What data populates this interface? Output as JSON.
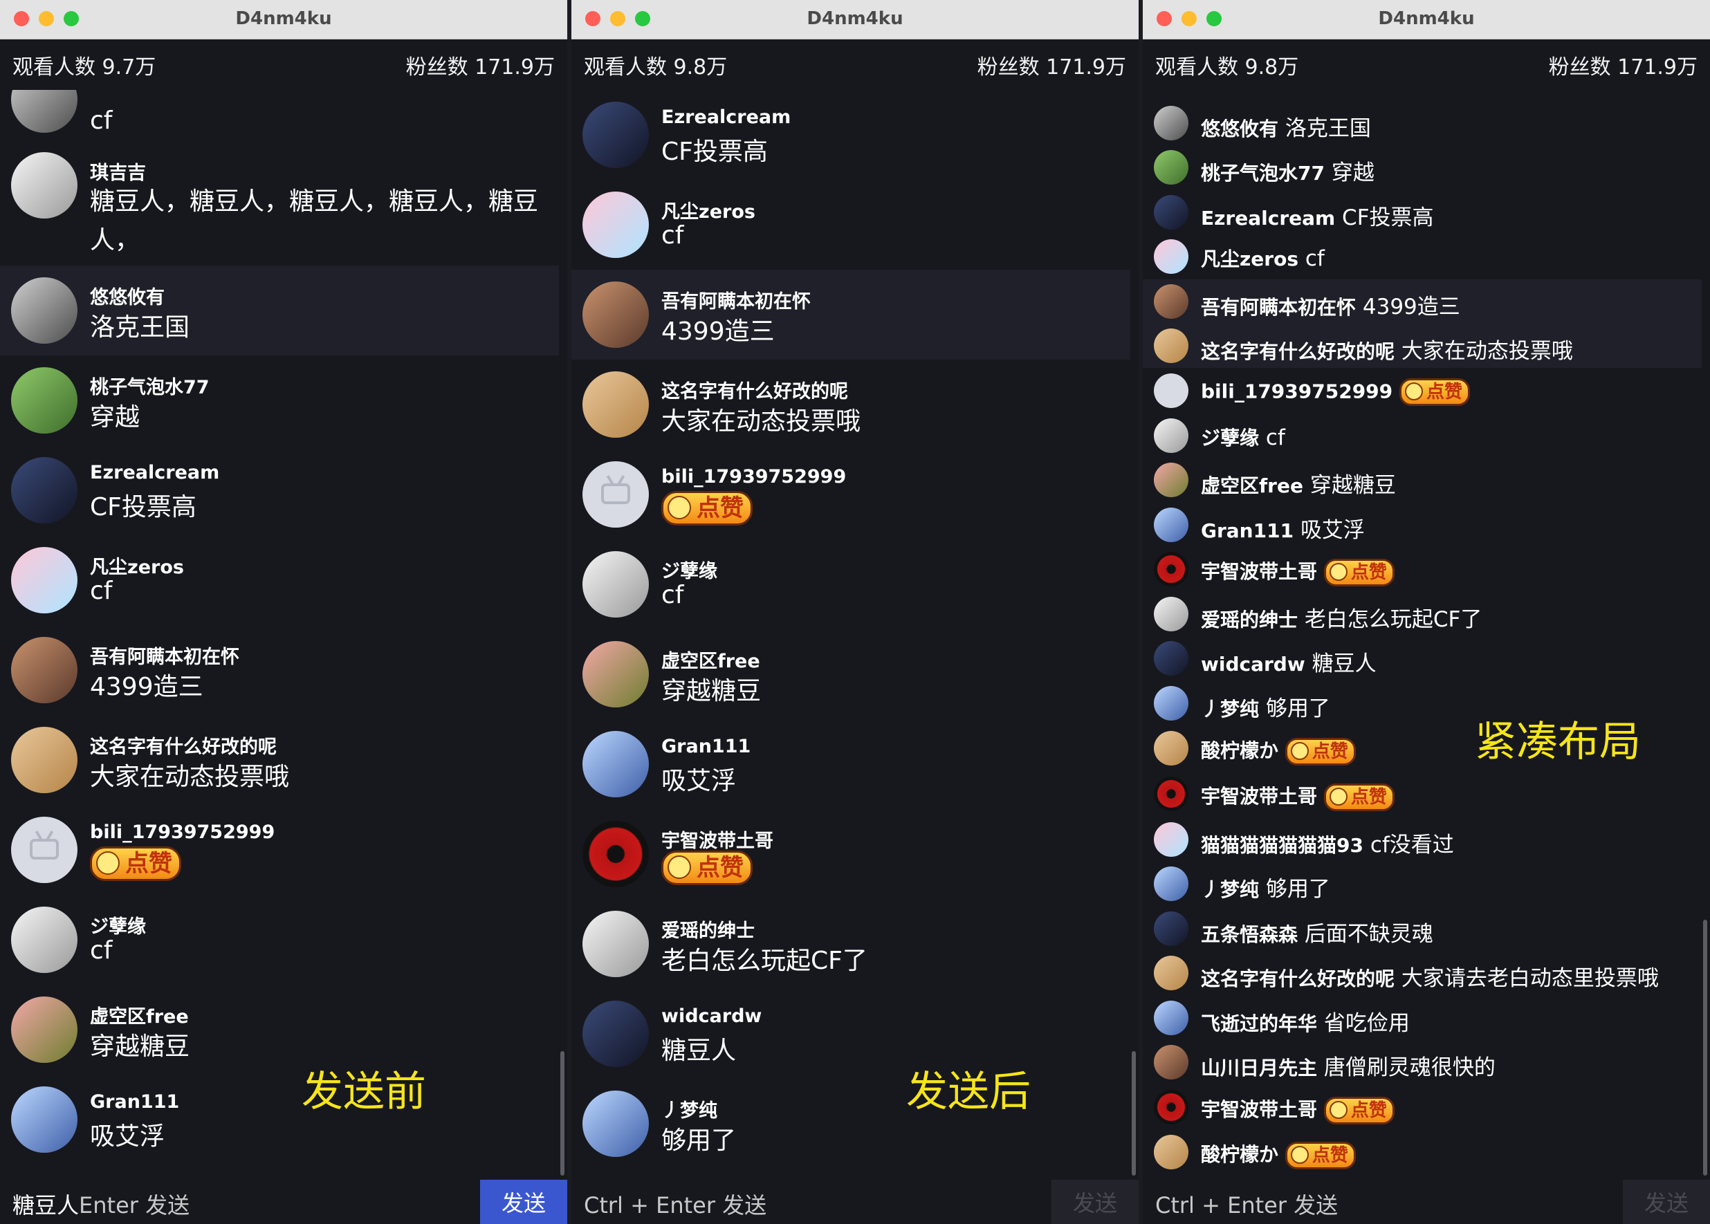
{
  "window_title": "D4nm4ku",
  "colors": {
    "send_active": "#3a57d0",
    "caption": "#f6e51a",
    "background": "#17181e"
  },
  "windows": [
    {
      "viewers": "观看人数 9.7万",
      "fans": "粉丝数 171.9万",
      "caption": "发送前",
      "items": [
        {
          "user": "",
          "text": "cf"
        },
        {
          "user": "琪吉吉",
          "text": "糖豆人，糖豆人，糖豆人，糖豆人，糖豆人，"
        },
        {
          "user": "悠悠攸有",
          "text": "洛克王国"
        },
        {
          "user": "桃子气泡水77",
          "text": "穿越"
        },
        {
          "user": "Ezrealcream",
          "text": "CF投票高"
        },
        {
          "user": "凡尘zeros",
          "text": "cf"
        },
        {
          "user": "吾有阿瞒本初在怀",
          "text": "4399造三"
        },
        {
          "user": "这名字有什么好改的呢",
          "text": "大家在动态投票哦"
        },
        {
          "user": "bili_17939752999",
          "text": "点赞"
        },
        {
          "user": "ジ孽缘",
          "text": "cf"
        },
        {
          "user": "虚空区free",
          "text": "穿越糖豆"
        },
        {
          "user": "Gran111",
          "text": "吸艾浮"
        }
      ],
      "input_value": "糖豆人",
      "input_placeholder": "Enter 发送",
      "send_label": "发送"
    },
    {
      "viewers": "观看人数 9.8万",
      "fans": "粉丝数 171.9万",
      "caption": "发送后",
      "items": [
        {
          "user": "Ezrealcream",
          "text": "CF投票高"
        },
        {
          "user": "凡尘zeros",
          "text": "cf"
        },
        {
          "user": "吾有阿瞒本初在怀",
          "text": "4399造三"
        },
        {
          "user": "这名字有什么好改的呢",
          "text": "大家在动态投票哦"
        },
        {
          "user": "bili_17939752999",
          "text": "点赞"
        },
        {
          "user": "ジ孽缘",
          "text": "cf"
        },
        {
          "user": "虚空区free",
          "text": "穿越糖豆"
        },
        {
          "user": "Gran111",
          "text": "吸艾浮"
        },
        {
          "user": "宇智波带土哥",
          "text": "点赞"
        },
        {
          "user": "爱瑶的绅士",
          "text": "老白怎么玩起CF了"
        },
        {
          "user": "widcardw",
          "text": "糖豆人"
        },
        {
          "user": "丿梦纯",
          "text": "够用了"
        }
      ],
      "input_placeholder": "Ctrl + Enter 发送",
      "send_label": "发送"
    },
    {
      "viewers": "观看人数 9.8万",
      "fans": "粉丝数 171.9万",
      "caption": "紧凑布局",
      "items": [
        {
          "user": "悠悠攸有",
          "text": "洛克王国"
        },
        {
          "user": "桃子气泡水77",
          "text": "穿越"
        },
        {
          "user": "Ezrealcream",
          "text": "CF投票高"
        },
        {
          "user": "凡尘zeros",
          "text": "cf"
        },
        {
          "user": "吾有阿瞒本初在怀",
          "text": "4399造三"
        },
        {
          "user": "这名字有什么好改的呢",
          "text": "大家在动态投票哦"
        },
        {
          "user": "bili_17939752999",
          "text": "点赞"
        },
        {
          "user": "ジ孽缘",
          "text": "cf"
        },
        {
          "user": "虚空区free",
          "text": "穿越糖豆"
        },
        {
          "user": "Gran111",
          "text": "吸艾浮"
        },
        {
          "user": "宇智波带土哥",
          "text": "点赞"
        },
        {
          "user": "爱瑶的绅士",
          "text": "老白怎么玩起CF了"
        },
        {
          "user": "widcardw",
          "text": "糖豆人"
        },
        {
          "user": "丿梦纯",
          "text": "够用了"
        },
        {
          "user": "酸柠檬か",
          "text": "点赞"
        },
        {
          "user": "宇智波带土哥",
          "text": "点赞"
        },
        {
          "user": "猫猫猫猫猫猫猫93",
          "text": "cf没看过"
        },
        {
          "user": "丿梦纯",
          "text": "够用了"
        },
        {
          "user": "五条悟森森",
          "text": "后面不缺灵魂"
        },
        {
          "user": "这名字有什么好改的呢",
          "text": "大家请去老白动态里投票哦"
        },
        {
          "user": "飞逝过的年华",
          "text": "省吃俭用"
        },
        {
          "user": "山川日月先主",
          "text": "唐僧刷灵魂很快的"
        },
        {
          "user": "宇智波带土哥",
          "text": "点赞"
        },
        {
          "user": "酸柠檬か",
          "text": "点赞"
        }
      ],
      "input_placeholder": "Ctrl + Enter 发送",
      "send_label": "发送"
    }
  ]
}
